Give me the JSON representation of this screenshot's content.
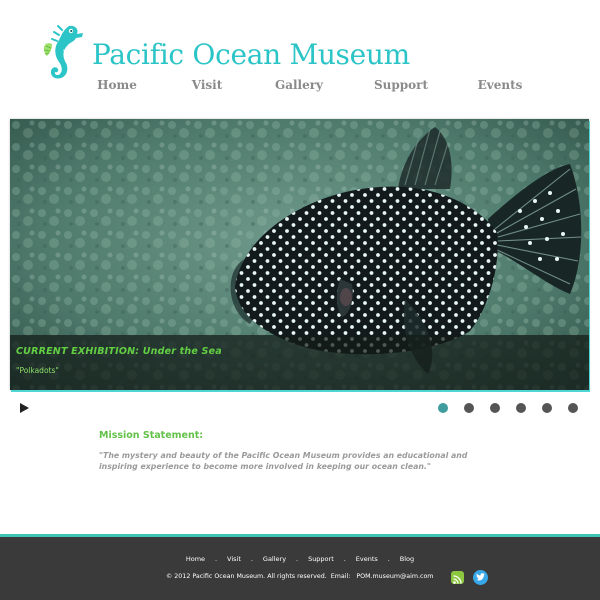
{
  "site": {
    "title": "Pacific Ocean Museum"
  },
  "nav": {
    "items": [
      "Home",
      "Visit",
      "Gallery",
      "Support",
      "Events"
    ]
  },
  "hero": {
    "caption_title": "CURRENT EXHIBITION: Under the Sea",
    "caption_subtitle": "\"Polkadots\"",
    "slide_count": 6,
    "active_slide": 1
  },
  "mission": {
    "title": "Mission Statement:",
    "text": "\"The mystery and beauty of the Pacific Ocean Museum provides an educational and inspiring experience to become more involved in keeping our ocean clean.\""
  },
  "footer": {
    "links": [
      "Home",
      "Visit",
      "Gallery",
      "Support",
      "Events",
      "Blog"
    ],
    "separator": ".",
    "copyright": "© 2012 Pacific Ocean Museum. All rights reserved.",
    "email_label": "Email:",
    "email": "POM.museum@aim.com"
  },
  "icons": {
    "logo": "seahorse-icon",
    "play": "play-icon",
    "rss": "rss-icon",
    "twitter": "twitter-icon"
  },
  "colors": {
    "brand": "#2bc5c7",
    "accent_green": "#63c14a",
    "footer_bg": "#3a3a3a",
    "footer_line": "#3cc4b6",
    "active_dot": "#3f9e9d",
    "inactive_dot": "#555555"
  }
}
